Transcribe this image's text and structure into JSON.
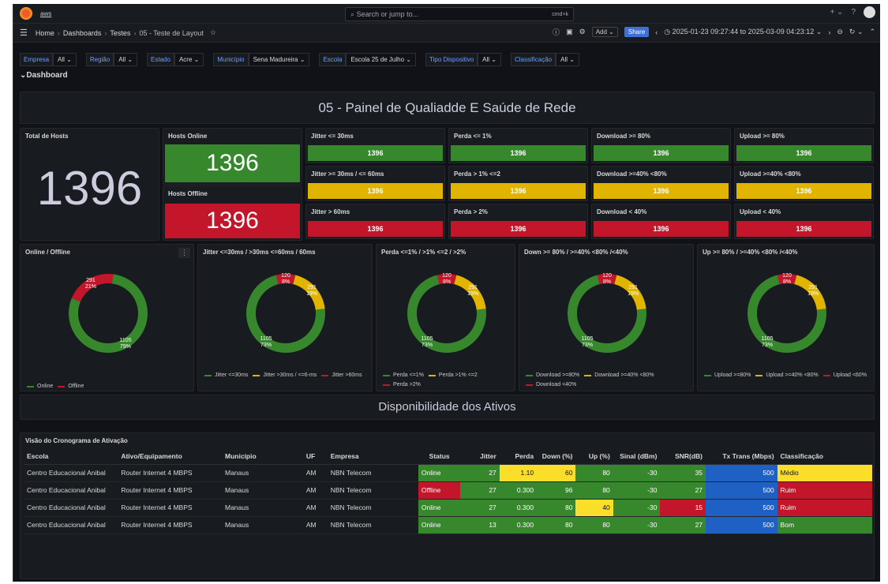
{
  "topbar": {
    "brand": "aws",
    "search_placeholder": "Search or jump to...",
    "shortcut": "cmd+k"
  },
  "nav": {
    "breadcrumbs": [
      "Home",
      "Dashboards",
      "Testes",
      "05 - Teste de Layout"
    ],
    "add_label": "Add",
    "share_label": "Share",
    "time_range": "2025-01-23 09:27:44 to 2025-03-09 04:23:12"
  },
  "variables": [
    {
      "label": "Empresa",
      "value": "All"
    },
    {
      "label": "Região",
      "value": "All"
    },
    {
      "label": "Estado",
      "value": "Acre"
    },
    {
      "label": "Município",
      "value": "Sena Madureira"
    },
    {
      "label": "Escola",
      "value": "Escola 25 de Julho"
    },
    {
      "label": "Tipo Dispositivo",
      "value": "All"
    },
    {
      "label": "Classificação",
      "value": "All"
    }
  ],
  "row_title": "Dashboard",
  "main_title": "05 - Painel de Qualiadde E Saúde de Rede",
  "stats": {
    "total_title": "Total de Hosts",
    "total_value": "1396",
    "online_title": "Hosts Online",
    "online_value": "1396",
    "offline_title": "Hosts Offline",
    "offline_value": "1396"
  },
  "bars": [
    {
      "title": "Jitter <= 30ms",
      "value": "1396",
      "color": "green"
    },
    {
      "title": "Perda <= 1%",
      "value": "1396",
      "color": "green"
    },
    {
      "title": "Download >= 80%",
      "value": "1396",
      "color": "green"
    },
    {
      "title": "Upload >= 80%",
      "value": "1396",
      "color": "green"
    },
    {
      "title": "Jitter >= 30ms / <= 60ms",
      "value": "1396",
      "color": "yellow"
    },
    {
      "title": "Perda > 1% <=2",
      "value": "1396",
      "color": "yellow"
    },
    {
      "title": "Download >=40% <80%",
      "value": "1396",
      "color": "yellow"
    },
    {
      "title": "Upload >=40% <80%",
      "value": "1396",
      "color": "yellow"
    },
    {
      "title": "Jitter > 60ms",
      "value": "1396",
      "color": "red"
    },
    {
      "title": "Perda > 2%",
      "value": "1396",
      "color": "red"
    },
    {
      "title": "Download < 40%",
      "value": "1396",
      "color": "red"
    },
    {
      "title": "Upload < 40%",
      "value": "1396",
      "color": "red"
    }
  ],
  "colors": {
    "green": "#37872d",
    "yellow": "#e0b400",
    "red": "#c4162a"
  },
  "chart_data": [
    {
      "type": "pie",
      "title": "Online / Offline",
      "slices": [
        {
          "label": "Online",
          "value": 1105,
          "pct": "79%",
          "color": "#37872d"
        },
        {
          "label": "Offline",
          "value": 291,
          "pct": "21%",
          "color": "#c4162a"
        }
      ]
    },
    {
      "type": "pie",
      "title": "Jitter <=30ms / >30ms <=60ms / 60ms",
      "slices": [
        {
          "label": "Jitter <=30ms",
          "value": 1105,
          "pct": "73%",
          "color": "#37872d"
        },
        {
          "label": "Jitter >30ms / <=6-ms",
          "value": 291,
          "pct": "19%",
          "color": "#e0b400"
        },
        {
          "label": "Jitter >60ms",
          "value": 120,
          "pct": "8%",
          "color": "#c4162a"
        }
      ]
    },
    {
      "type": "pie",
      "title": "Perda <=1% / >1% <=2 / >2%",
      "slices": [
        {
          "label": "Perda <=1%",
          "value": 1105,
          "pct": "73%",
          "color": "#37872d"
        },
        {
          "label": "Perda >1% <=2",
          "value": 291,
          "pct": "19%",
          "color": "#e0b400"
        },
        {
          "label": "Perda >2%",
          "value": 120,
          "pct": "8%",
          "color": "#c4162a"
        }
      ]
    },
    {
      "type": "pie",
      "title": "Down >= 80% / >=40% <80% /<40%",
      "slices": [
        {
          "label": "Download >=80%",
          "value": 1105,
          "pct": "73%",
          "color": "#37872d"
        },
        {
          "label": "Download >=40% <80%",
          "value": 291,
          "pct": "19%",
          "color": "#e0b400"
        },
        {
          "label": "Download <40%",
          "value": 120,
          "pct": "8%",
          "color": "#c4162a"
        }
      ]
    },
    {
      "type": "pie",
      "title": "Up >= 80% / >=40% <80% /<40%",
      "slices": [
        {
          "label": "Upload >=80%",
          "value": 1105,
          "pct": "73%",
          "color": "#37872d"
        },
        {
          "label": "Upload >=40% <80%",
          "value": 291,
          "pct": "19%",
          "color": "#e0b400"
        },
        {
          "label": "Upload <60%",
          "value": 120,
          "pct": "8%",
          "color": "#c4162a"
        }
      ]
    }
  ],
  "availability_title": "Disponibilidade dos Ativos",
  "table": {
    "title": "Visão do Cronograma de Ativação",
    "columns": [
      "Escola",
      "Ativo/Equipamento",
      "Município",
      "UF",
      "Empresa",
      "Status",
      "Jitter",
      "Perda",
      "Down (%)",
      "Up (%)",
      "Sinal (dBm)",
      "SNR(dB)",
      "Tx Trans (Mbps)",
      "Classificação"
    ],
    "rows": [
      [
        "Centro Educacional Anibal",
        "Router Internet 4 MBPS",
        "Manaus",
        "AM",
        "NBN Telecom",
        "Online",
        "27",
        "1.10",
        "60",
        "80",
        "-30",
        "35",
        "500",
        "Médio"
      ],
      [
        "Centro Educacional Anibal",
        "Router Internet 4 MBPS",
        "Manaus",
        "AM",
        "NBN Telecom",
        "Offline",
        "27",
        "0.300",
        "96",
        "80",
        "-30",
        "27",
        "500",
        "Ruim"
      ],
      [
        "Centro Educacional Anibal",
        "Router Internet 4 MBPS",
        "Manaus",
        "AM",
        "NBN Telecom",
        "Online",
        "27",
        "0.300",
        "80",
        "40",
        "-30",
        "15",
        "500",
        "Ruim"
      ],
      [
        "Centro Educacional Anibal",
        "Router Internet 4 MBPS",
        "Manaus",
        "AM",
        "NBN Telecom",
        "Online",
        "13",
        "0.300",
        "80",
        "80",
        "-30",
        "27",
        "500",
        "Bom"
      ]
    ],
    "cell_colors": [
      [
        "",
        "",
        "",
        "",
        "",
        "green",
        "green",
        "yellow",
        "yellow",
        "green",
        "green",
        "green",
        "blue",
        "yellow"
      ],
      [
        "",
        "",
        "",
        "",
        "",
        "red",
        "green",
        "green",
        "green",
        "green",
        "green",
        "green",
        "blue",
        "red"
      ],
      [
        "",
        "",
        "",
        "",
        "",
        "green",
        "green",
        "green",
        "green",
        "yellow",
        "green",
        "red",
        "blue",
        "red"
      ],
      [
        "",
        "",
        "",
        "",
        "",
        "green",
        "green",
        "green",
        "green",
        "green",
        "green",
        "green",
        "blue",
        "green"
      ]
    ]
  }
}
